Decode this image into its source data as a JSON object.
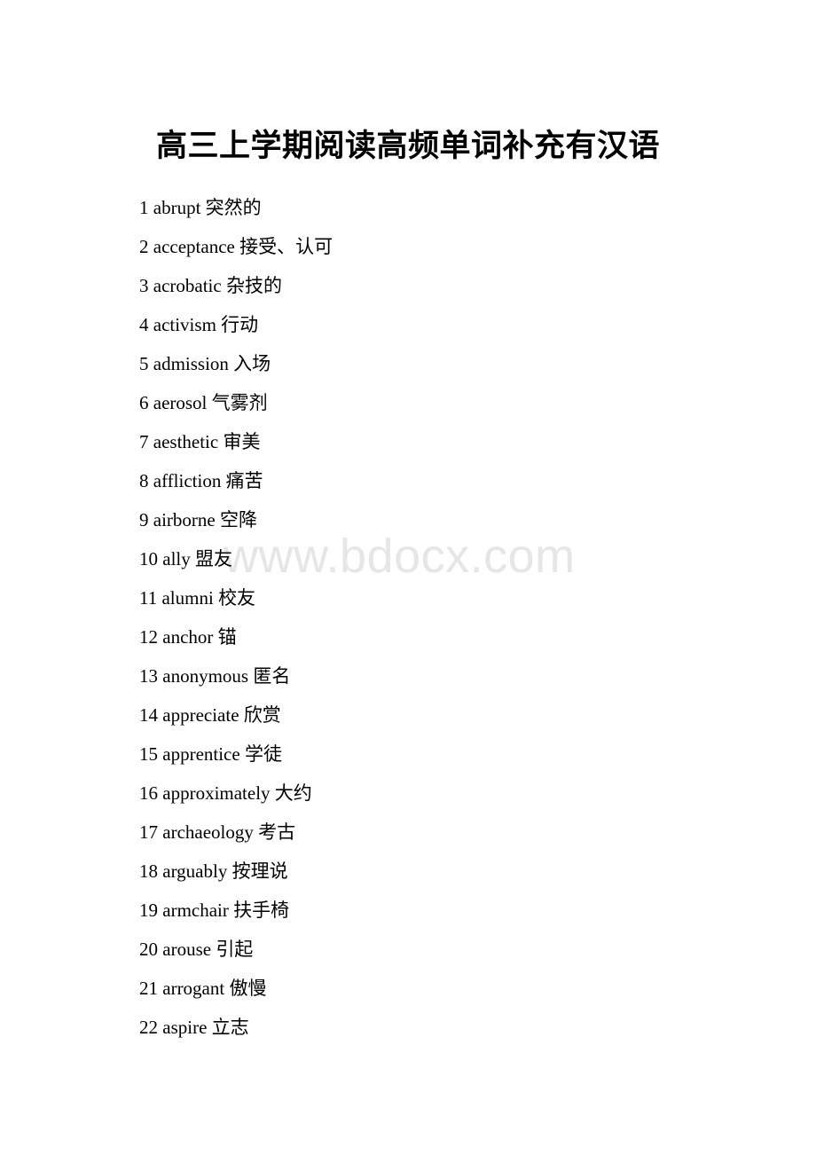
{
  "document": {
    "title": "高三上学期阅读高频单词补充有汉语",
    "background_color": "#ffffff",
    "text_color": "#000000"
  },
  "watermark": {
    "text": "www.bdocx.com",
    "color": "#e6e6e6"
  },
  "word_list": [
    {
      "number": "1",
      "term": "abrupt",
      "gloss": "突然的"
    },
    {
      "number": "2",
      "term": "acceptance",
      "gloss": "接受、认可"
    },
    {
      "number": "3",
      "term": "acrobatic",
      "gloss": "杂技的"
    },
    {
      "number": "4",
      "term": "activism",
      "gloss": "行动"
    },
    {
      "number": "5",
      "term": "admission",
      "gloss": "入场"
    },
    {
      "number": "6",
      "term": "aerosol",
      "gloss": "气雾剂"
    },
    {
      "number": "7",
      "term": "aesthetic",
      "gloss": "审美"
    },
    {
      "number": "8",
      "term": "affliction",
      "gloss": "痛苦"
    },
    {
      "number": "9",
      "term": "airborne",
      "gloss": "空降"
    },
    {
      "number": "10",
      "term": "ally",
      "gloss": "盟友"
    },
    {
      "number": "11",
      "term": "alumni",
      "gloss": "校友"
    },
    {
      "number": "12",
      "term": "anchor",
      "gloss": "锚"
    },
    {
      "number": "13",
      "term": "anonymous",
      "gloss": "匿名"
    },
    {
      "number": "14",
      "term": "appreciate",
      "gloss": "欣赏"
    },
    {
      "number": "15",
      "term": "apprentice",
      "gloss": "学徒"
    },
    {
      "number": "16",
      "term": "approximately",
      "gloss": "大约"
    },
    {
      "number": "17",
      "term": "archaeology",
      "gloss": "考古"
    },
    {
      "number": "18",
      "term": "arguably",
      "gloss": "按理说"
    },
    {
      "number": "19",
      "term": "armchair",
      "gloss": "扶手椅"
    },
    {
      "number": "20",
      "term": "arouse",
      "gloss": "引起"
    },
    {
      "number": "21",
      "term": "arrogant",
      "gloss": "傲慢"
    },
    {
      "number": "22",
      "term": "aspire",
      "gloss": "立志"
    }
  ]
}
